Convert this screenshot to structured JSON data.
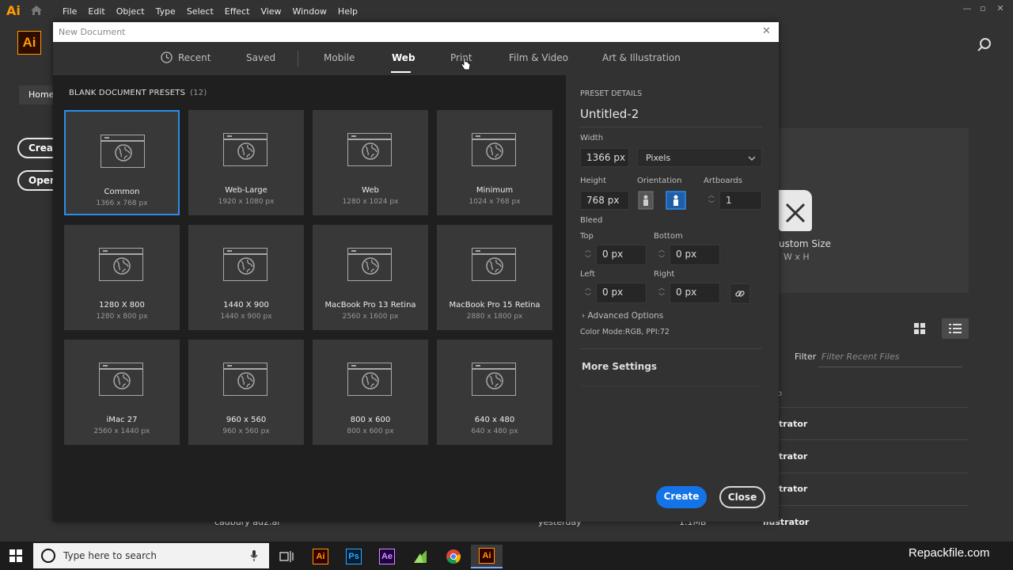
{
  "menubar": {
    "app_icon": "Ai",
    "menus": [
      "File",
      "Edit",
      "Object",
      "Type",
      "Select",
      "Effect",
      "View",
      "Window",
      "Help"
    ]
  },
  "background": {
    "logo": "Ai",
    "home_label": "Home",
    "create_label": "Create",
    "open_label": "Open.",
    "custom_size": "ustom Size",
    "wxh": "W x H",
    "filter_label": "Filter",
    "filter_placeholder": "Filter Recent Files",
    "row_col_header": "o",
    "rows": [
      "trator",
      "trator",
      "trator",
      "llustrator"
    ],
    "bottom_row": {
      "name": "cadbury ad2.ai",
      "date": "yesterday",
      "size": "1.1MB"
    }
  },
  "dialog": {
    "title": "New Document",
    "tabs": [
      {
        "label": "Recent"
      },
      {
        "label": "Saved"
      },
      {
        "label": "Mobile"
      },
      {
        "label": "Web",
        "active": true
      },
      {
        "label": "Print"
      },
      {
        "label": "Film & Video"
      },
      {
        "label": "Art & Illustration"
      }
    ],
    "presets_header": "BLANK DOCUMENT PRESETS",
    "presets_count": "(12)",
    "presets": [
      {
        "name": "Common",
        "size": "1366 x 768 px",
        "selected": true
      },
      {
        "name": "Web-Large",
        "size": "1920 x 1080 px"
      },
      {
        "name": "Web",
        "size": "1280 x 1024 px"
      },
      {
        "name": "Minimum",
        "size": "1024 x 768 px"
      },
      {
        "name": "1280 X 800",
        "size": "1280 x 800 px"
      },
      {
        "name": "1440 X 900",
        "size": "1440 x 900 px"
      },
      {
        "name": "MacBook Pro 13 Retina",
        "size": "2560 x 1600 px"
      },
      {
        "name": "MacBook Pro 15 Retina",
        "size": "2880 x 1800 px"
      },
      {
        "name": "iMac 27",
        "size": "2560 x 1440 px"
      },
      {
        "name": "960 x 560",
        "size": "960 x 560 px"
      },
      {
        "name": "800 x 600",
        "size": "800 x 600 px"
      },
      {
        "name": "640 x 480",
        "size": "640 x 480 px"
      }
    ],
    "details": {
      "header": "PRESET DETAILS",
      "doc_name": "Untitled-2",
      "width_label": "Width",
      "width_value": "1366 px",
      "units": "Pixels",
      "height_label": "Height",
      "height_value": "768 px",
      "orientation_label": "Orientation",
      "artboards_label": "Artboards",
      "artboards_value": "1",
      "bleed_label": "Bleed",
      "top_label": "Top",
      "top_value": "0 px",
      "bottom_label": "Bottom",
      "bottom_value": "0 px",
      "left_label": "Left",
      "left_value": "0 px",
      "right_label": "Right",
      "right_value": "0 px",
      "advanced_options": "Advanced Options",
      "color_mode": "Color Mode:RGB, PPI:72",
      "more_settings": "More Settings",
      "create_label": "Create",
      "close_label": "Close"
    }
  },
  "taskbar": {
    "search_placeholder": "Type here to search",
    "apps": [
      {
        "icon": "task-view-icon",
        "label": ""
      },
      {
        "icon": "illustrator-icon",
        "label": "Ai"
      },
      {
        "icon": "photoshop-icon",
        "label": "Ps"
      },
      {
        "icon": "after-effects-icon",
        "label": "Ae"
      },
      {
        "icon": "camtasia-icon",
        "label": ""
      },
      {
        "icon": "chrome-icon",
        "label": ""
      },
      {
        "icon": "illustrator-active-icon",
        "label": "Ai"
      }
    ]
  },
  "watermark": "Repackfile.com",
  "colors": {
    "accent": "#1473e6",
    "ai_orange": "#ff9a00",
    "selection": "#2d8ceb"
  }
}
